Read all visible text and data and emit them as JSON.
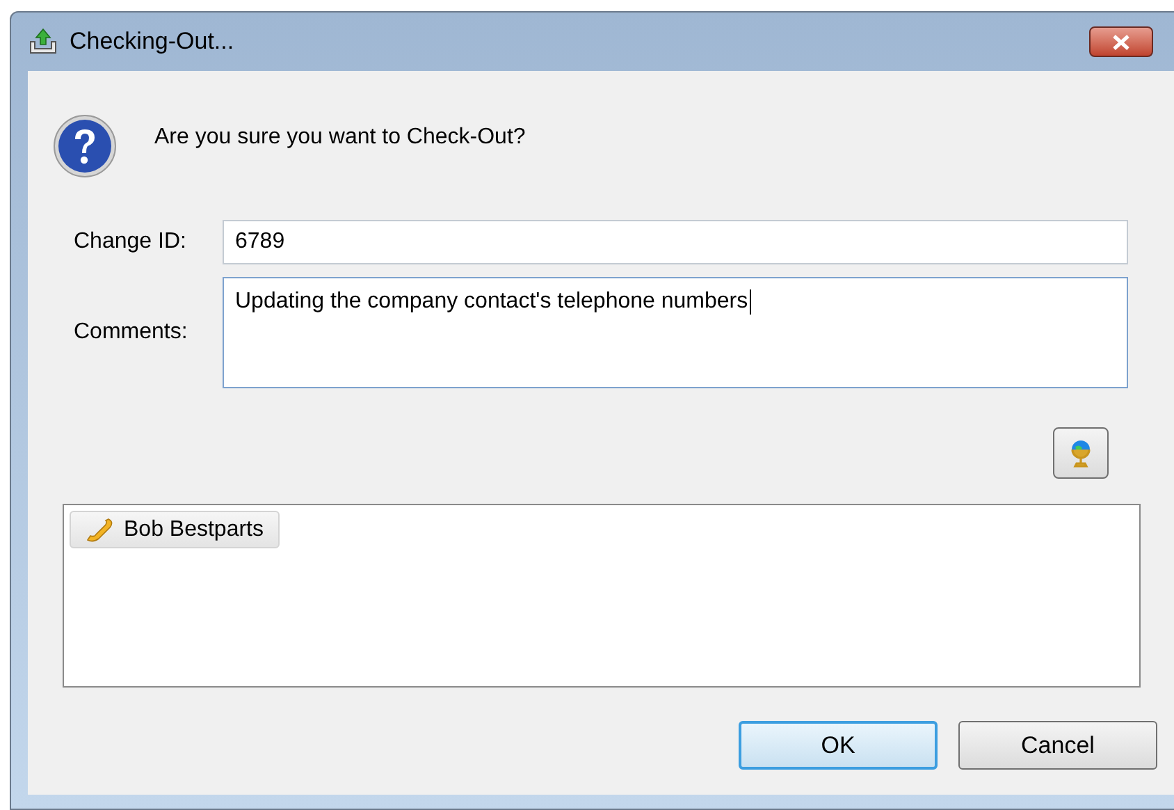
{
  "window": {
    "title": "Checking-Out..."
  },
  "message": "Are you sure you want to Check-Out?",
  "change_id": {
    "label": "Change ID:",
    "value": "6789"
  },
  "comments": {
    "label": "Comments:",
    "value": "Updating the company contact's telephone numbers"
  },
  "recipients": [
    {
      "name": "Bob Bestparts"
    }
  ],
  "buttons": [
    {
      "label": "OK",
      "default": true
    },
    {
      "label": "Cancel",
      "default": false
    }
  ]
}
